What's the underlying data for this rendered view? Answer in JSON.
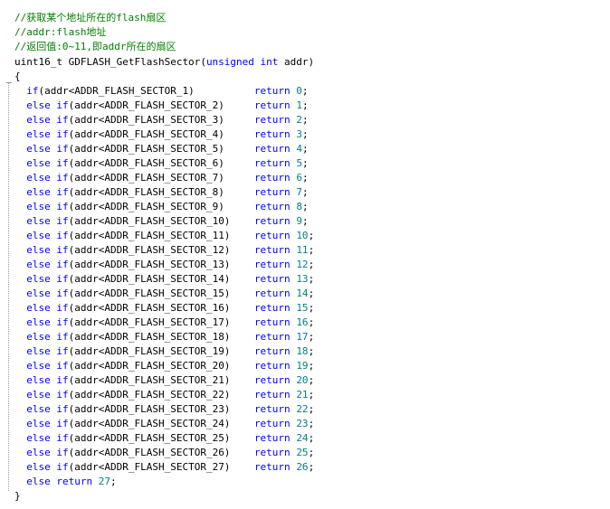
{
  "comments": [
    "//获取某个地址所在的flash扇区",
    "//addr:flash地址",
    "//返回值:0~11,即addr所在的扇区"
  ],
  "signature": {
    "return_type": "uint16_t",
    "func_name": "GDFLASH_GetFlashSector",
    "paren_open": "(",
    "param_kw1": "unsigned",
    "param_kw2": "int",
    "param_name": "addr",
    "paren_close": ")"
  },
  "open_brace": "{",
  "close_brace": "}",
  "first_if": {
    "kw": "if",
    "cond": "(addr<ADDR_FLASH_SECTOR_1)",
    "ret": "return",
    "val": "0",
    "semi": ";"
  },
  "else_if_rows": [
    {
      "kw1": "else",
      "kw2": "if",
      "cond": "(addr<ADDR_FLASH_SECTOR_2)",
      "ret": "return",
      "val": "1",
      "semi": ";"
    },
    {
      "kw1": "else",
      "kw2": "if",
      "cond": "(addr<ADDR_FLASH_SECTOR_3)",
      "ret": "return",
      "val": "2",
      "semi": ";"
    },
    {
      "kw1": "else",
      "kw2": "if",
      "cond": "(addr<ADDR_FLASH_SECTOR_4)",
      "ret": "return",
      "val": "3",
      "semi": ";"
    },
    {
      "kw1": "else",
      "kw2": "if",
      "cond": "(addr<ADDR_FLASH_SECTOR_5)",
      "ret": "return",
      "val": "4",
      "semi": ";"
    },
    {
      "kw1": "else",
      "kw2": "if",
      "cond": "(addr<ADDR_FLASH_SECTOR_6)",
      "ret": "return",
      "val": "5",
      "semi": ";"
    },
    {
      "kw1": "else",
      "kw2": "if",
      "cond": "(addr<ADDR_FLASH_SECTOR_7)",
      "ret": "return",
      "val": "6",
      "semi": ";"
    },
    {
      "kw1": "else",
      "kw2": "if",
      "cond": "(addr<ADDR_FLASH_SECTOR_8)",
      "ret": "return",
      "val": "7",
      "semi": ";"
    },
    {
      "kw1": "else",
      "kw2": "if",
      "cond": "(addr<ADDR_FLASH_SECTOR_9)",
      "ret": "return",
      "val": "8",
      "semi": ";"
    },
    {
      "kw1": "else",
      "kw2": "if",
      "cond": "(addr<ADDR_FLASH_SECTOR_10)",
      "ret": "return",
      "val": "9",
      "semi": ";"
    },
    {
      "kw1": "else",
      "kw2": "if",
      "cond": "(addr<ADDR_FLASH_SECTOR_11)",
      "ret": "return",
      "val": "10",
      "semi": ";"
    },
    {
      "kw1": "else",
      "kw2": "if",
      "cond": "(addr<ADDR_FLASH_SECTOR_12)",
      "ret": "return",
      "val": "11",
      "semi": ";"
    },
    {
      "kw1": "else",
      "kw2": "if",
      "cond": "(addr<ADDR_FLASH_SECTOR_13)",
      "ret": "return",
      "val": "12",
      "semi": ";"
    },
    {
      "kw1": "else",
      "kw2": "if",
      "cond": "(addr<ADDR_FLASH_SECTOR_14)",
      "ret": "return",
      "val": "13",
      "semi": ";"
    },
    {
      "kw1": "else",
      "kw2": "if",
      "cond": "(addr<ADDR_FLASH_SECTOR_15)",
      "ret": "return",
      "val": "14",
      "semi": ";"
    },
    {
      "kw1": "else",
      "kw2": "if",
      "cond": "(addr<ADDR_FLASH_SECTOR_16)",
      "ret": "return",
      "val": "15",
      "semi": ";"
    },
    {
      "kw1": "else",
      "kw2": "if",
      "cond": "(addr<ADDR_FLASH_SECTOR_17)",
      "ret": "return",
      "val": "16",
      "semi": ";"
    },
    {
      "kw1": "else",
      "kw2": "if",
      "cond": "(addr<ADDR_FLASH_SECTOR_18)",
      "ret": "return",
      "val": "17",
      "semi": ";"
    },
    {
      "kw1": "else",
      "kw2": "if",
      "cond": "(addr<ADDR_FLASH_SECTOR_19)",
      "ret": "return",
      "val": "18",
      "semi": ";"
    },
    {
      "kw1": "else",
      "kw2": "if",
      "cond": "(addr<ADDR_FLASH_SECTOR_20)",
      "ret": "return",
      "val": "19",
      "semi": ";"
    },
    {
      "kw1": "else",
      "kw2": "if",
      "cond": "(addr<ADDR_FLASH_SECTOR_21)",
      "ret": "return",
      "val": "20",
      "semi": ";"
    },
    {
      "kw1": "else",
      "kw2": "if",
      "cond": "(addr<ADDR_FLASH_SECTOR_22)",
      "ret": "return",
      "val": "21",
      "semi": ";"
    },
    {
      "kw1": "else",
      "kw2": "if",
      "cond": "(addr<ADDR_FLASH_SECTOR_23)",
      "ret": "return",
      "val": "22",
      "semi": ";"
    },
    {
      "kw1": "else",
      "kw2": "if",
      "cond": "(addr<ADDR_FLASH_SECTOR_24)",
      "ret": "return",
      "val": "23",
      "semi": ";"
    },
    {
      "kw1": "else",
      "kw2": "if",
      "cond": "(addr<ADDR_FLASH_SECTOR_25)",
      "ret": "return",
      "val": "24",
      "semi": ";"
    },
    {
      "kw1": "else",
      "kw2": "if",
      "cond": "(addr<ADDR_FLASH_SECTOR_26)",
      "ret": "return",
      "val": "25",
      "semi": ";"
    },
    {
      "kw1": "else",
      "kw2": "if",
      "cond": "(addr<ADDR_FLASH_SECTOR_27)",
      "ret": "return",
      "val": "26",
      "semi": ";"
    }
  ],
  "else_return": {
    "kw1": "else",
    "ret": "return",
    "val": "27",
    "semi": ";"
  }
}
